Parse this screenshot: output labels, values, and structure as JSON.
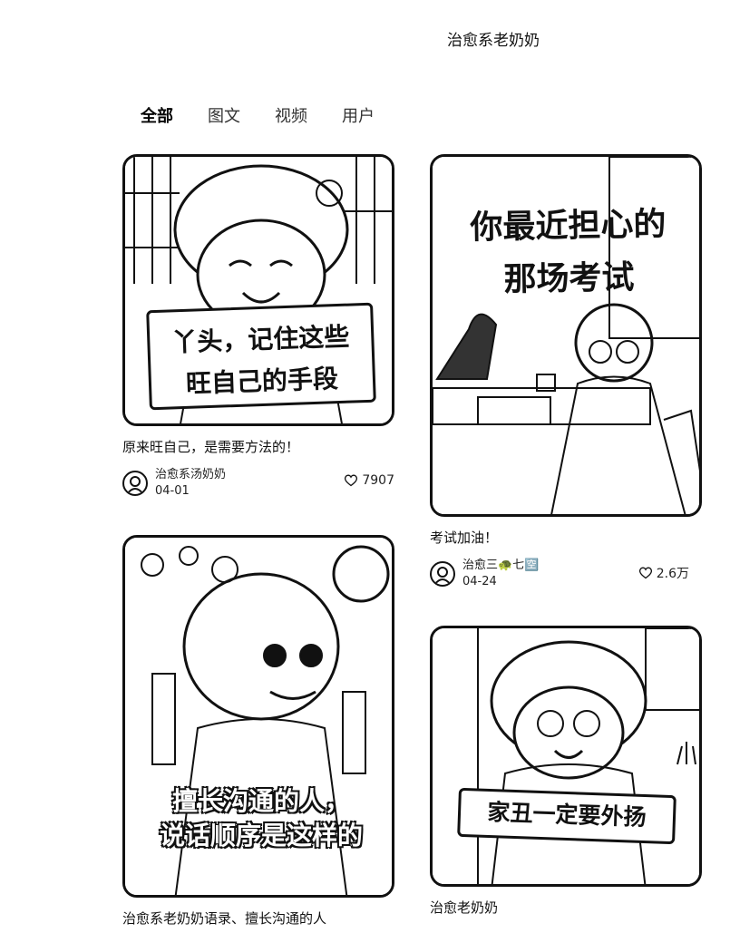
{
  "header": {
    "title": "治愈系老奶奶"
  },
  "tabs": [
    {
      "label": "全部",
      "active": true
    },
    {
      "label": "图文",
      "active": false
    },
    {
      "label": "视频",
      "active": false
    },
    {
      "label": "用户",
      "active": false
    }
  ],
  "posts": [
    {
      "image_text": [
        "丫头，记住这些",
        "旺自己的手段"
      ],
      "title": "原来旺自己，是需要方法的！",
      "author": "治愈系汤奶奶",
      "date": "04-01",
      "likes": "7907"
    },
    {
      "image_text": [
        "你最近担心的",
        "那场考试"
      ],
      "title": "考试加油！",
      "author": "治愈三🐢七🈳",
      "date": "04-24",
      "likes": "2.6万"
    },
    {
      "image_text": [
        "擅长沟通的人，",
        "说话顺序是这样的"
      ],
      "title": "治愈系老奶奶语录、擅长沟通的人",
      "author": "",
      "date": "",
      "likes": ""
    },
    {
      "image_text": [
        "家丑一定要外扬"
      ],
      "title": "治愈老奶奶",
      "author": "",
      "date": "",
      "likes": ""
    }
  ],
  "icons": {
    "like": "heart-outline-icon",
    "avatar": "user-avatar"
  },
  "colors": {
    "ink": "#111111",
    "background": "#ffffff"
  }
}
